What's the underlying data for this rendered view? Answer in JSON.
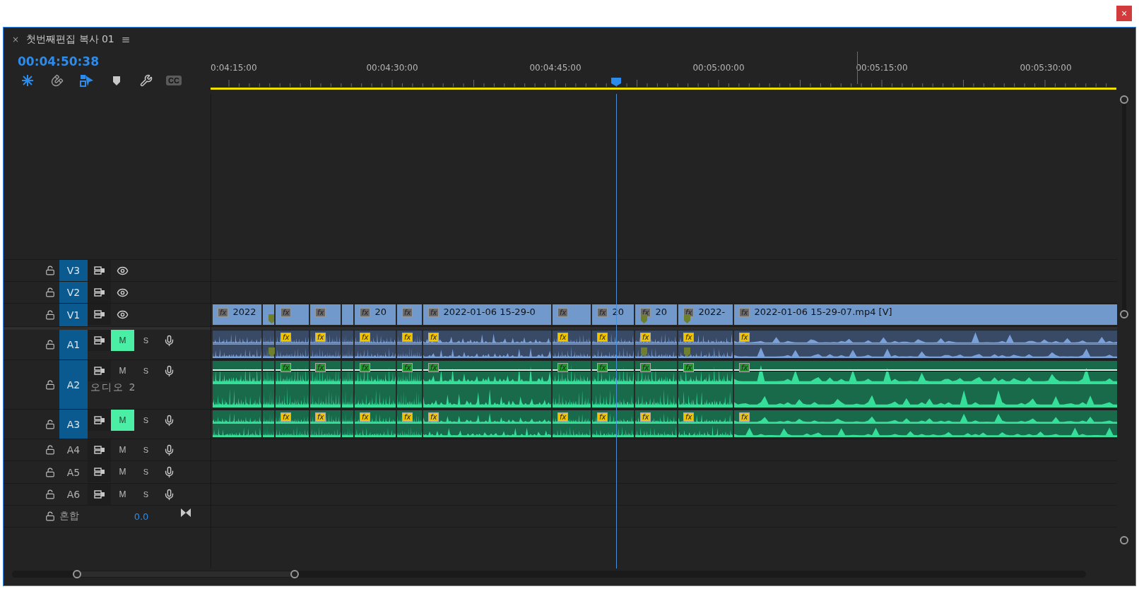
{
  "window": {
    "close": "×"
  },
  "panel": {
    "close": "×",
    "title": "첫번째편집 복사 01",
    "menu": "≡"
  },
  "timecode": "00:04:50:38",
  "toolbar": [
    {
      "kind": "nest",
      "on": true
    },
    {
      "kind": "magnet",
      "on": false
    },
    {
      "kind": "linked",
      "on": true
    },
    {
      "kind": "marker"
    },
    {
      "kind": "wrench"
    },
    {
      "kind": "captions",
      "label": "CC"
    }
  ],
  "ruler": {
    "labels": [
      "0:04:15:00",
      "00:04:30:00",
      "00:04:45:00",
      "00:05:00:00",
      "00:05:15:00",
      "00:05:30:00"
    ]
  },
  "video_tracks": [
    {
      "name": "V3",
      "targeted": true
    },
    {
      "name": "V2",
      "targeted": true
    },
    {
      "name": "V1",
      "targeted": true
    }
  ],
  "v1_clips": [
    {
      "label": "2022",
      "fx": "fx",
      "marker": false
    },
    {
      "marker": true
    },
    {
      "fx": "fx",
      "marker": false
    },
    {
      "fx": "fx",
      "marker": false
    },
    {
      "marker": false
    },
    {
      "label": "20",
      "fx": "fx",
      "marker": false
    },
    {
      "fx": "fx",
      "marker": false
    },
    {
      "label": "2022-01-06 15-29-0",
      "fx": "fx",
      "marker": false
    },
    {
      "fx": "fx",
      "marker": false
    },
    {
      "label": "20",
      "fx": "fx",
      "marker": false
    },
    {
      "label": "20",
      "fx": "fx",
      "marker": true
    },
    {
      "label": "2022-",
      "fx": "fx",
      "marker": true
    },
    {
      "label": "2022-01-06 15-29-07.mp4 [V]",
      "fx": "fx",
      "marker": false
    }
  ],
  "audio_tracks": [
    {
      "name": "A1",
      "targeted": true,
      "mute": "M",
      "solo": "S",
      "muted": true,
      "kind": "gold",
      "clips": [
        {
          "marker": false
        },
        {
          "marker": true
        },
        {
          "fx": "fx",
          "marker": false
        },
        {
          "fx": "fx",
          "marker": false
        },
        {
          "marker": false
        },
        {
          "fx": "fx",
          "marker": false
        },
        {
          "fx": "fx",
          "marker": false
        },
        {
          "fx": "fx",
          "marker": false
        },
        {
          "fx": "fx",
          "marker": false
        },
        {
          "fx": "fx",
          "marker": false
        },
        {
          "fx": "fx",
          "marker": true
        },
        {
          "fx": "fx",
          "marker": true
        },
        {
          "fx": "fx",
          "marker": false
        }
      ]
    },
    {
      "name": "A2",
      "targeted": true,
      "mute": "M",
      "solo": "S",
      "muted": false,
      "track_name": "오디오 2",
      "kind": "green",
      "clips": [
        {
          "marker": false
        },
        {
          "marker": false
        },
        {
          "fx": "fx",
          "marker": false
        },
        {
          "fx": "fx",
          "marker": false
        },
        {
          "marker": false
        },
        {
          "fx": "fx",
          "marker": false
        },
        {
          "fx": "fx",
          "marker": false
        },
        {
          "fx": "fx",
          "marker": false
        },
        {
          "fx": "fx",
          "marker": false
        },
        {
          "fx": "fx",
          "marker": false
        },
        {
          "fx": "fx",
          "marker": false
        },
        {
          "fx": "fx",
          "marker": false
        },
        {
          "fx": "fx",
          "marker": false
        }
      ]
    },
    {
      "name": "A3",
      "targeted": true,
      "mute": "M",
      "solo": "S",
      "muted": true,
      "kind": "gold",
      "clips": [
        {
          "marker": false
        },
        {
          "marker": false
        },
        {
          "fx": "fx",
          "marker": false
        },
        {
          "fx": "fx",
          "marker": false
        },
        {
          "marker": false
        },
        {
          "fx": "fx",
          "marker": false
        },
        {
          "fx": "fx",
          "marker": false
        },
        {
          "fx": "fx",
          "marker": false
        },
        {
          "fx": "fx",
          "marker": false
        },
        {
          "fx": "fx",
          "marker": false
        },
        {
          "fx": "fx",
          "marker": false
        },
        {
          "fx": "fx",
          "marker": false
        },
        {
          "fx": "fx",
          "marker": false
        }
      ]
    },
    {
      "name": "A4",
      "targeted": false,
      "mute": "M",
      "solo": "S",
      "muted": false
    },
    {
      "name": "A5",
      "targeted": false,
      "mute": "M",
      "solo": "S",
      "muted": false
    },
    {
      "name": "A6",
      "targeted": false,
      "mute": "M",
      "solo": "S",
      "muted": false
    }
  ],
  "mix": {
    "label": "혼합",
    "value": "0.0"
  }
}
